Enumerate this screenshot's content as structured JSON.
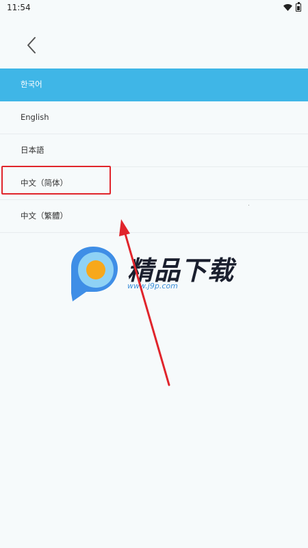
{
  "status_bar": {
    "time": "11:54",
    "icons": [
      "wifi-icon",
      "battery-icon"
    ]
  },
  "nav": {
    "back_icon": "chevron-left-icon"
  },
  "languages": {
    "items": [
      {
        "label": "한국어",
        "selected": true
      },
      {
        "label": "English",
        "selected": false
      },
      {
        "label": "日本語",
        "selected": false
      },
      {
        "label": "中文（简体）",
        "selected": false
      },
      {
        "label": "中文（繁體）",
        "selected": false
      }
    ]
  },
  "watermark": {
    "title": "精品下载",
    "url": "www.j9p.com"
  },
  "colors": {
    "accent": "#3fb6e7",
    "annotation": "#e0242b",
    "background": "#f6fafb"
  }
}
